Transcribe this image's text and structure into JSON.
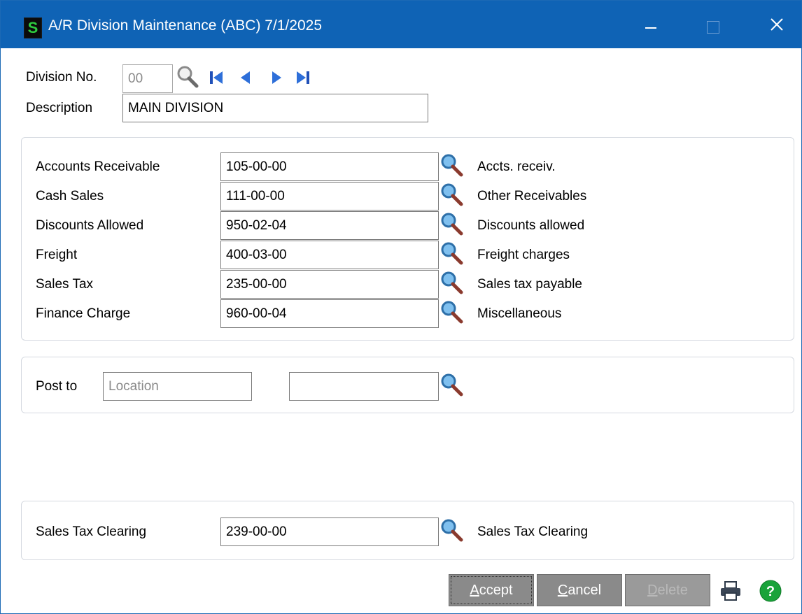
{
  "window": {
    "app_icon_letter": "S",
    "title": "A/R Division Maintenance (ABC) 7/1/2025"
  },
  "header": {
    "division_label": "Division No.",
    "division_value": "00",
    "description_label": "Description",
    "description_value": "MAIN DIVISION"
  },
  "accounts": [
    {
      "label": "Accounts Receivable",
      "value": "105-00-00",
      "desc": "Accts. receiv."
    },
    {
      "label": "Cash Sales",
      "value": "111-00-00",
      "desc": "Other Receivables"
    },
    {
      "label": "Discounts Allowed",
      "value": "950-02-04",
      "desc": "Discounts allowed"
    },
    {
      "label": "Freight",
      "value": "400-03-00",
      "desc": "Freight charges"
    },
    {
      "label": "Sales Tax",
      "value": "235-00-00",
      "desc": "Sales tax payable"
    },
    {
      "label": "Finance Charge",
      "value": "960-00-04",
      "desc": "Miscellaneous"
    }
  ],
  "post_to": {
    "label": "Post to",
    "selected": "Location",
    "value": ""
  },
  "clearing": {
    "label": "Sales Tax Clearing",
    "value": "239-00-00",
    "desc": "Sales Tax Clearing"
  },
  "buttons": {
    "accept": {
      "hotkey": "A",
      "rest": "ccept"
    },
    "cancel": {
      "hotkey": "C",
      "rest": "ancel"
    },
    "delete": {
      "hotkey": "D",
      "rest": "elete"
    }
  },
  "icons": {
    "print": "printer-icon",
    "help": "help-icon",
    "lookup": "magnifier-icon"
  },
  "colors": {
    "titlebar": "#0f63b5",
    "button": "#8a8a8a",
    "help_green": "#1aa33a"
  }
}
